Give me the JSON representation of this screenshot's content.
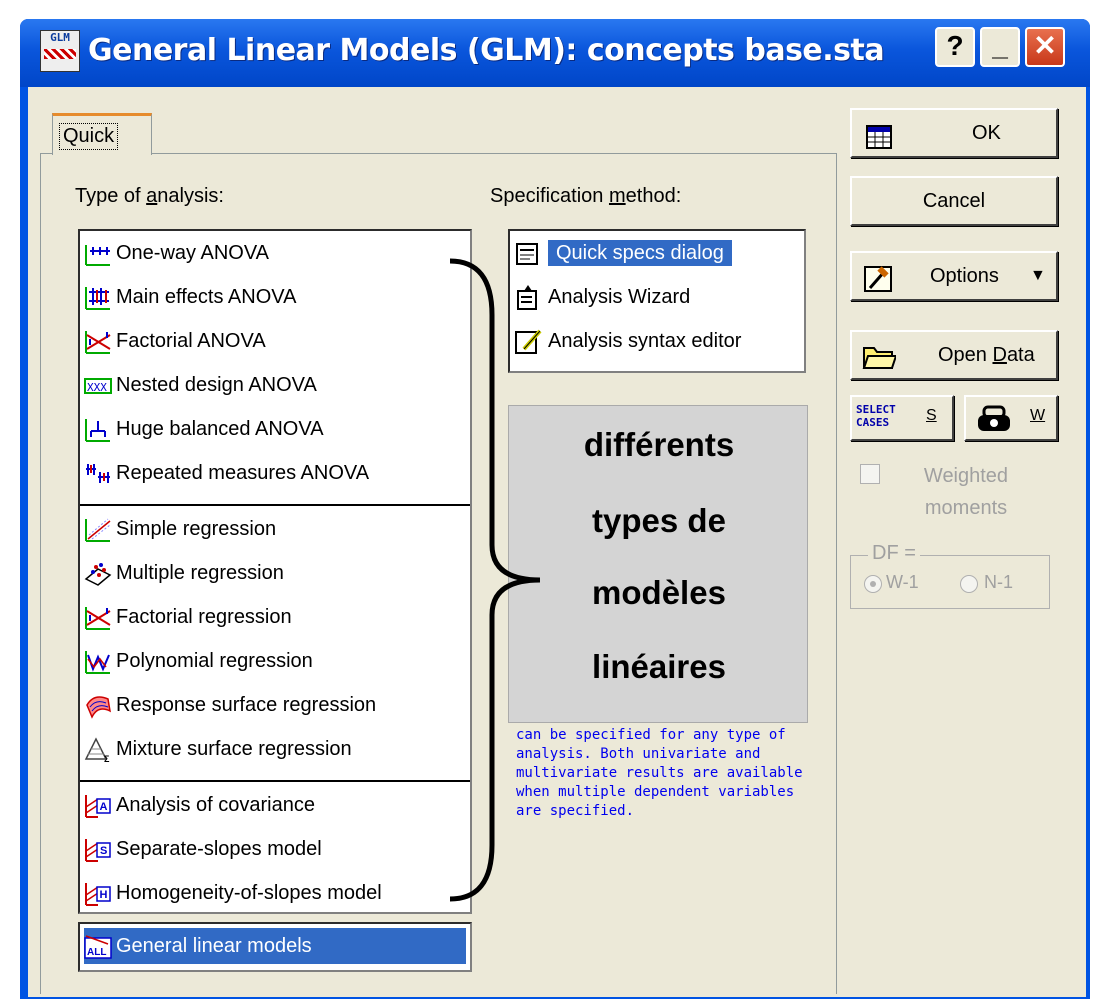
{
  "window": {
    "title": "General Linear Models (GLM): concepts base.sta",
    "app_icon_text": "GLM",
    "help_label": "?",
    "minimize_label": "_",
    "close_label": "✕"
  },
  "tab": {
    "label": "Quick"
  },
  "analysis": {
    "label_prefix": "Type of ",
    "label_underlined": "a",
    "label_suffix": "nalysis:",
    "items": [
      {
        "label": "One-way ANOVA",
        "icon": "one-way-anova-icon"
      },
      {
        "label": "Main effects ANOVA",
        "icon": "main-effects-icon"
      },
      {
        "label": "Factorial ANOVA",
        "icon": "factorial-icon"
      },
      {
        "label": "Nested design ANOVA",
        "icon": "nested-design-icon"
      },
      {
        "label": "Huge balanced ANOVA",
        "icon": "huge-balanced-icon"
      },
      {
        "label": "Repeated measures ANOVA",
        "icon": "repeated-measures-icon"
      },
      {
        "label": "Simple regression",
        "icon": "simple-regression-icon"
      },
      {
        "label": "Multiple regression",
        "icon": "multiple-regression-icon"
      },
      {
        "label": "Factorial regression",
        "icon": "factorial-regression-icon"
      },
      {
        "label": "Polynomial regression",
        "icon": "polynomial-regression-icon"
      },
      {
        "label": "Response surface regression",
        "icon": "response-surface-icon"
      },
      {
        "label": "Mixture surface regression",
        "icon": "mixture-surface-icon"
      },
      {
        "label": "Analysis of covariance",
        "icon": "covariance-icon"
      },
      {
        "label": "Separate-slopes model",
        "icon": "separate-slopes-icon"
      },
      {
        "label": "Homogeneity-of-slopes model",
        "icon": "homogeneity-slopes-icon"
      }
    ],
    "general_item": {
      "label": "General linear models",
      "icon": "general-linear-icon",
      "icon_text": "ALL",
      "selected": true
    }
  },
  "specification": {
    "label_prefix": "Specification ",
    "label_underlined": "m",
    "label_suffix": "ethod:",
    "items": [
      {
        "label": "Quick specs dialog",
        "selected": true,
        "icon": "quick-specs-icon"
      },
      {
        "label": "Analysis Wizard",
        "selected": false,
        "icon": "wizard-icon"
      },
      {
        "label": "Analysis syntax editor",
        "selected": false,
        "icon": "syntax-editor-icon"
      }
    ]
  },
  "annotation": {
    "lines": [
      "différents",
      "types de",
      "modèles",
      "linéaires"
    ]
  },
  "description": "can be specified for any type of analysis.  Both univariate and multivariate results are available when multiple dependent variables are specified.",
  "buttons": {
    "ok": "OK",
    "cancel": "Cancel",
    "options": "Options",
    "open_data_prefix": "Open ",
    "open_data_underlined": "D",
    "open_data_suffix": "ata",
    "select_cases_icon_text": "SELECT CASES",
    "select_cases_key": "S",
    "weight_key": "W"
  },
  "weighted": {
    "label": "Weighted moments",
    "checked": false
  },
  "df": {
    "label": "DF =",
    "options": [
      {
        "label": "W-1",
        "selected": true
      },
      {
        "label": "N-1",
        "selected": false
      }
    ]
  },
  "colors": {
    "titlebar": "#0054e3",
    "selection": "#316ac5",
    "description_text": "#0000ee",
    "annotation_box": "#d4d4d4"
  }
}
